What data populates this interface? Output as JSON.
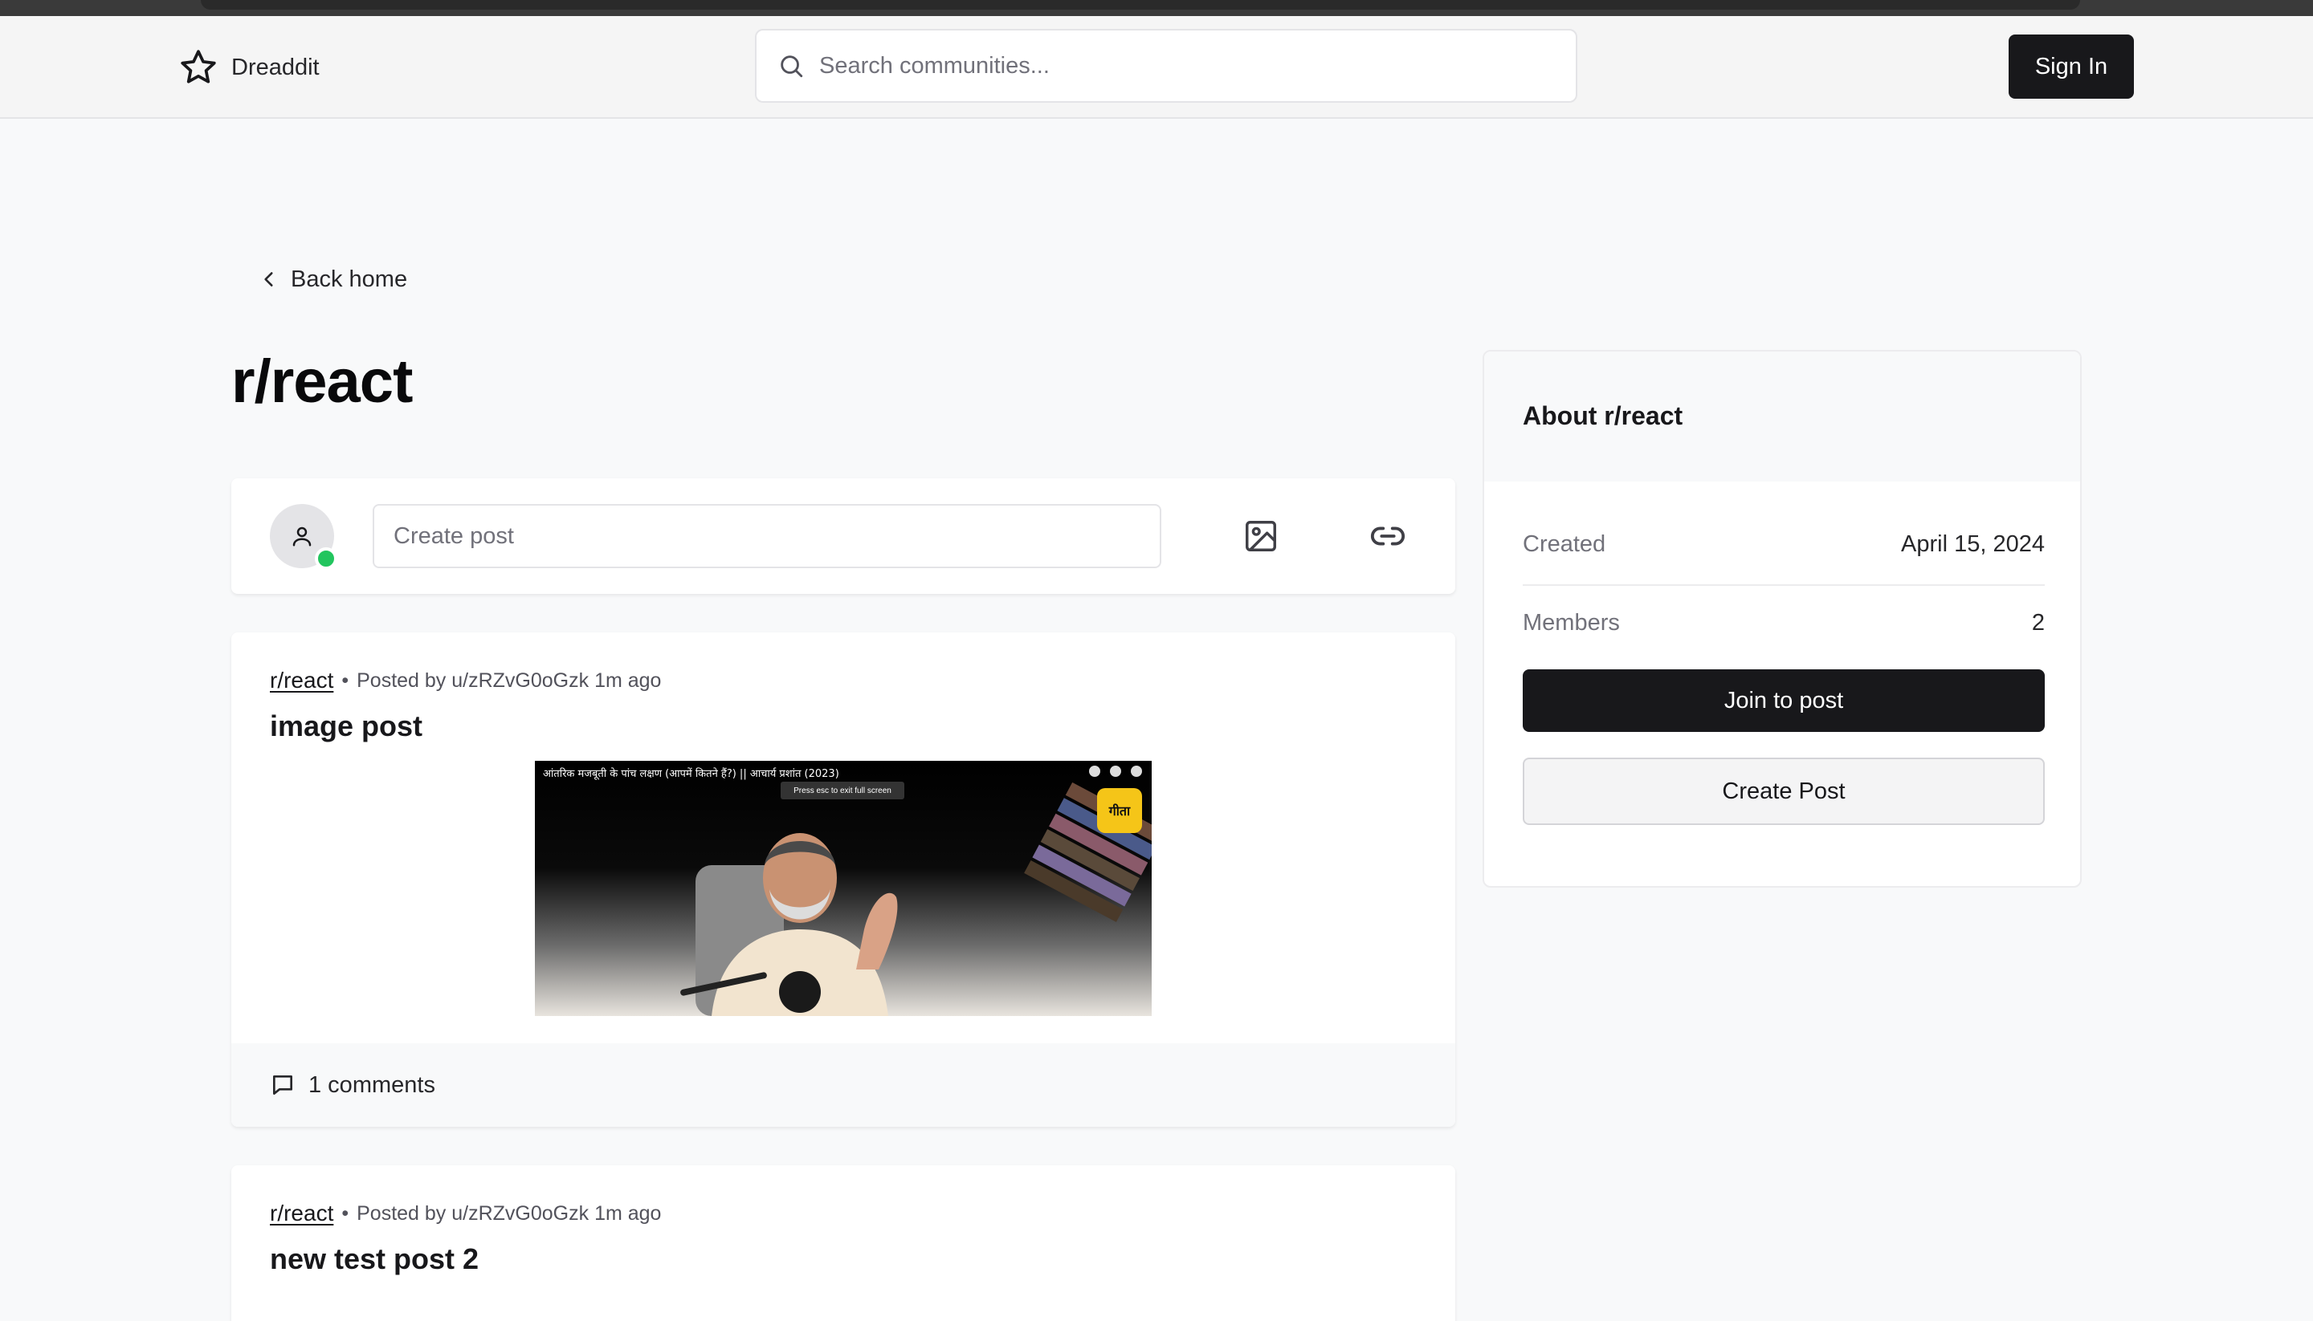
{
  "app": {
    "name": "Dreaddit"
  },
  "navbar": {
    "search_placeholder": "Search communities...",
    "signin_label": "Sign In"
  },
  "back_label": "Back home",
  "community": {
    "title": "r/react"
  },
  "create_post": {
    "placeholder": "Create post"
  },
  "posts": [
    {
      "subreddit": "r/react",
      "meta": "Posted by u/zRZvG0oGzk 1m ago",
      "title": "image post",
      "image_caption": "आंतरिक मजबूती के पांच लक्षण (आपमें कितने हैं?) || आचार्य प्रशांत (2023)",
      "image_hint": "Press esc to exit full screen",
      "image_badge": "गीता",
      "comments": "1 comments"
    },
    {
      "subreddit": "r/react",
      "meta": "Posted by u/zRZvG0oGzk 1m ago",
      "title": "new test post 2"
    }
  ],
  "about": {
    "title": "About r/react",
    "created_label": "Created",
    "created_value": "April 15, 2024",
    "members_label": "Members",
    "members_value": "2",
    "join_label": "Join to post",
    "create_label": "Create Post"
  },
  "colors": {
    "primary": "#18181b",
    "online": "#22c55e",
    "background": "#f8f9fa"
  }
}
